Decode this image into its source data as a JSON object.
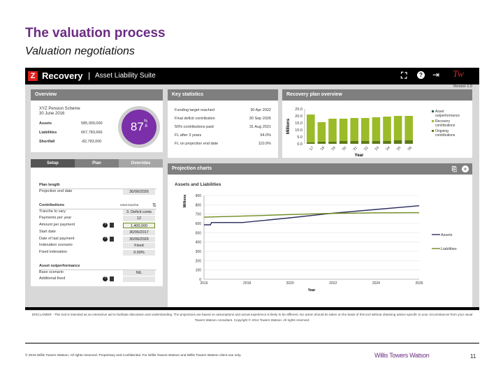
{
  "slide": {
    "title": "The valuation process",
    "subtitle": "Valuation negotiations",
    "page_number": "11",
    "footer": "© 2016 Willis Towers Watson. All rights reserved. Proprietary and Confidential. For Willis Towers Watson and Willis Towers Watson client use only.",
    "brand": "Willis Towers Watson"
  },
  "app": {
    "name": "Recovery",
    "suite": "Asset Liability Suite",
    "version": "Version 1.0",
    "icons": [
      "fullscreen-icon",
      "help-icon",
      "logout-icon",
      "logo-icon"
    ]
  },
  "overview": {
    "header": "Overview",
    "scheme": "XYZ Pension Scheme",
    "date": "30 June 2016",
    "rows": [
      {
        "label": "Assets",
        "value": "585,000,000"
      },
      {
        "label": "Liabilities",
        "value": "667,783,666"
      },
      {
        "label": "Shortfall",
        "value": "-82,783,000"
      }
    ],
    "funding_level": "87",
    "funding_decimal": ".6",
    "funding_pct": "%",
    "funding_fraction": 0.876,
    "accent": "#7b2fa8"
  },
  "key_stats": {
    "header": "Key statistics",
    "rows": [
      {
        "label": "Funding target reached",
        "value": "30 Apr 2022"
      },
      {
        "label": "Final deficit contribution",
        "value": "30 Sep 2026"
      },
      {
        "label": "50% contributions paid",
        "value": "31 Aug 2021"
      },
      {
        "label": "FL after 3 years",
        "value": "94.0%"
      },
      {
        "label": "FL on projection end date",
        "value": "110.9%"
      }
    ]
  },
  "recovery_chart": {
    "header": "Recovery plan overview",
    "ylabel": "Millions",
    "xlabel": "Year",
    "yticks": [
      "25.0",
      "20.0",
      "15.0",
      "10.0",
      "5.0",
      "0.0"
    ],
    "categories": [
      "'17",
      "'18",
      "'19",
      "'20",
      "'21",
      "'22",
      "'23",
      "'24",
      "'25",
      "'26"
    ],
    "legend": [
      "Asset outperformance",
      "Recovery contributions",
      "Ongoing contributions"
    ],
    "colors": {
      "asset": "#1f5c5c",
      "recovery": "#9bbb29",
      "ongoing": "#5e7a1a"
    }
  },
  "tabs": [
    {
      "label": "Setup"
    },
    {
      "label": "Plan"
    },
    {
      "label": "Overrides"
    }
  ],
  "plan": {
    "plan_length": {
      "title": "Plan length",
      "rows": [
        {
          "label": "Projection end date",
          "value": "30/06/2026"
        }
      ]
    },
    "contributions": {
      "title": "Contributions",
      "reset": "reset tranche",
      "rows": [
        {
          "label": "Tranche to vary",
          "value": "3. Deficit conts"
        },
        {
          "label": "Payments per year",
          "value": "12"
        },
        {
          "label": "Amount per payment",
          "value": "1,400,000",
          "icons": true
        },
        {
          "label": "Start date",
          "value": "30/06/2017"
        },
        {
          "label": "Date of last payment",
          "value": "30/06/2026",
          "icons": true
        },
        {
          "label": "Indexation scenario",
          "value": "Fixed"
        },
        {
          "label": "Fixed indexation",
          "value": "0.00%"
        }
      ]
    },
    "asset": {
      "title": "Asset outperformance",
      "rows": [
        {
          "label": "Base scenario",
          "value": "NIL"
        },
        {
          "label": "Additional fixed",
          "value": "",
          "icons": true
        }
      ]
    }
  },
  "projection": {
    "header": "Projection charts",
    "icons": [
      "copy-icon",
      "add-icon"
    ]
  },
  "chart_data": [
    {
      "type": "bar",
      "title": "Recovery plan overview",
      "ylabel": "Millions",
      "xlabel": "Year",
      "ylim": [
        0,
        25
      ],
      "categories": [
        "'17",
        "'18",
        "'19",
        "'20",
        "'21",
        "'22",
        "'23",
        "'24",
        "'25",
        "'26"
      ],
      "series": [
        {
          "name": "Ongoing contributions",
          "values": [
            1.0,
            1.5,
            1.5,
            2.0,
            2.0,
            2.0,
            2.0,
            2.0,
            2.5,
            2.5
          ]
        },
        {
          "name": "Recovery contributions",
          "values": [
            20.0,
            14.0,
            16.5,
            16.0,
            16.5,
            16.5,
            17.0,
            17.5,
            17.5,
            17.5
          ]
        },
        {
          "name": "Asset outperformance",
          "values": [
            0,
            0,
            0,
            0,
            0,
            0,
            0,
            0,
            0,
            0
          ]
        }
      ],
      "legend": "right"
    },
    {
      "type": "line",
      "title": "Assets and Liabilities",
      "ylabel": "Millions",
      "xlabel": "Year",
      "xlim": [
        2016,
        2026
      ],
      "ylim": [
        0,
        900
      ],
      "xticks": [
        "2016",
        "2018",
        "2020",
        "2022",
        "2024",
        "2026"
      ],
      "yticks": [
        "900",
        "800",
        "700",
        "600",
        "500",
        "400",
        "300",
        "200",
        "100",
        "0"
      ],
      "legend": "right",
      "series": [
        {
          "name": "Assets",
          "color": "#2b2f5e",
          "x": [
            2016,
            2016.3,
            2016.35,
            2017.8,
            2020,
            2022,
            2024,
            2026
          ],
          "y": [
            585,
            585,
            610,
            610,
            660,
            710,
            750,
            790
          ]
        },
        {
          "name": "Liabilities",
          "color": "#6e8b1f",
          "x": [
            2016,
            2018,
            2020,
            2022,
            2024,
            2026
          ],
          "y": [
            667,
            680,
            695,
            708,
            714,
            716
          ]
        }
      ]
    }
  ],
  "disclaimer": "DISCLAIMER - This tool is intended as an interactive aid to facilitate discussion and understanding. The projections are based on assumptions and actual experience is likely to be different. No action should be taken on the basis of this tool without obtaining advice specific to your circumstances from your usual Towers Watson consultant. Copyright © 2014 Towers Watson. All rights reserved."
}
